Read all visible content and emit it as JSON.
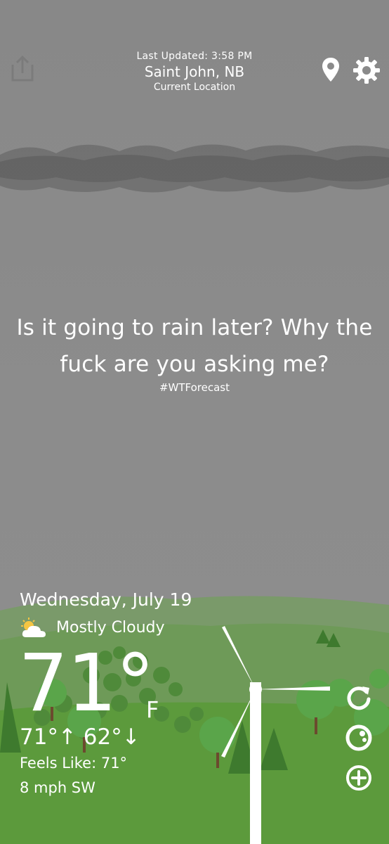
{
  "header": {
    "last_updated": "Last Updated: 3:58 PM",
    "city": "Saint John, NB",
    "location_label": "Current Location"
  },
  "message": {
    "quote": "Is it going to rain later? Why the fuck are you asking me?",
    "hashtag": "#WTForecast"
  },
  "weather": {
    "date": "Wednesday, July 19",
    "condition": "Mostly Cloudy",
    "temperature": "71°",
    "unit": "F",
    "hi_lo": "71°↑ 62°↓",
    "feels_like": "Feels Like: 71°",
    "wind": "8 mph SW"
  },
  "icons": {
    "share": "share-icon",
    "location": "map-pin-icon",
    "settings": "gear-icon",
    "condition": "partly-cloudy-icon",
    "refresh": "refresh-icon",
    "radar": "radar-icon",
    "add": "plus-circle-icon"
  },
  "colors": {
    "sky": "#8a8a8a",
    "text": "#ffffff",
    "grass": "#5c9a3c",
    "hills": "#6f9a5a"
  }
}
